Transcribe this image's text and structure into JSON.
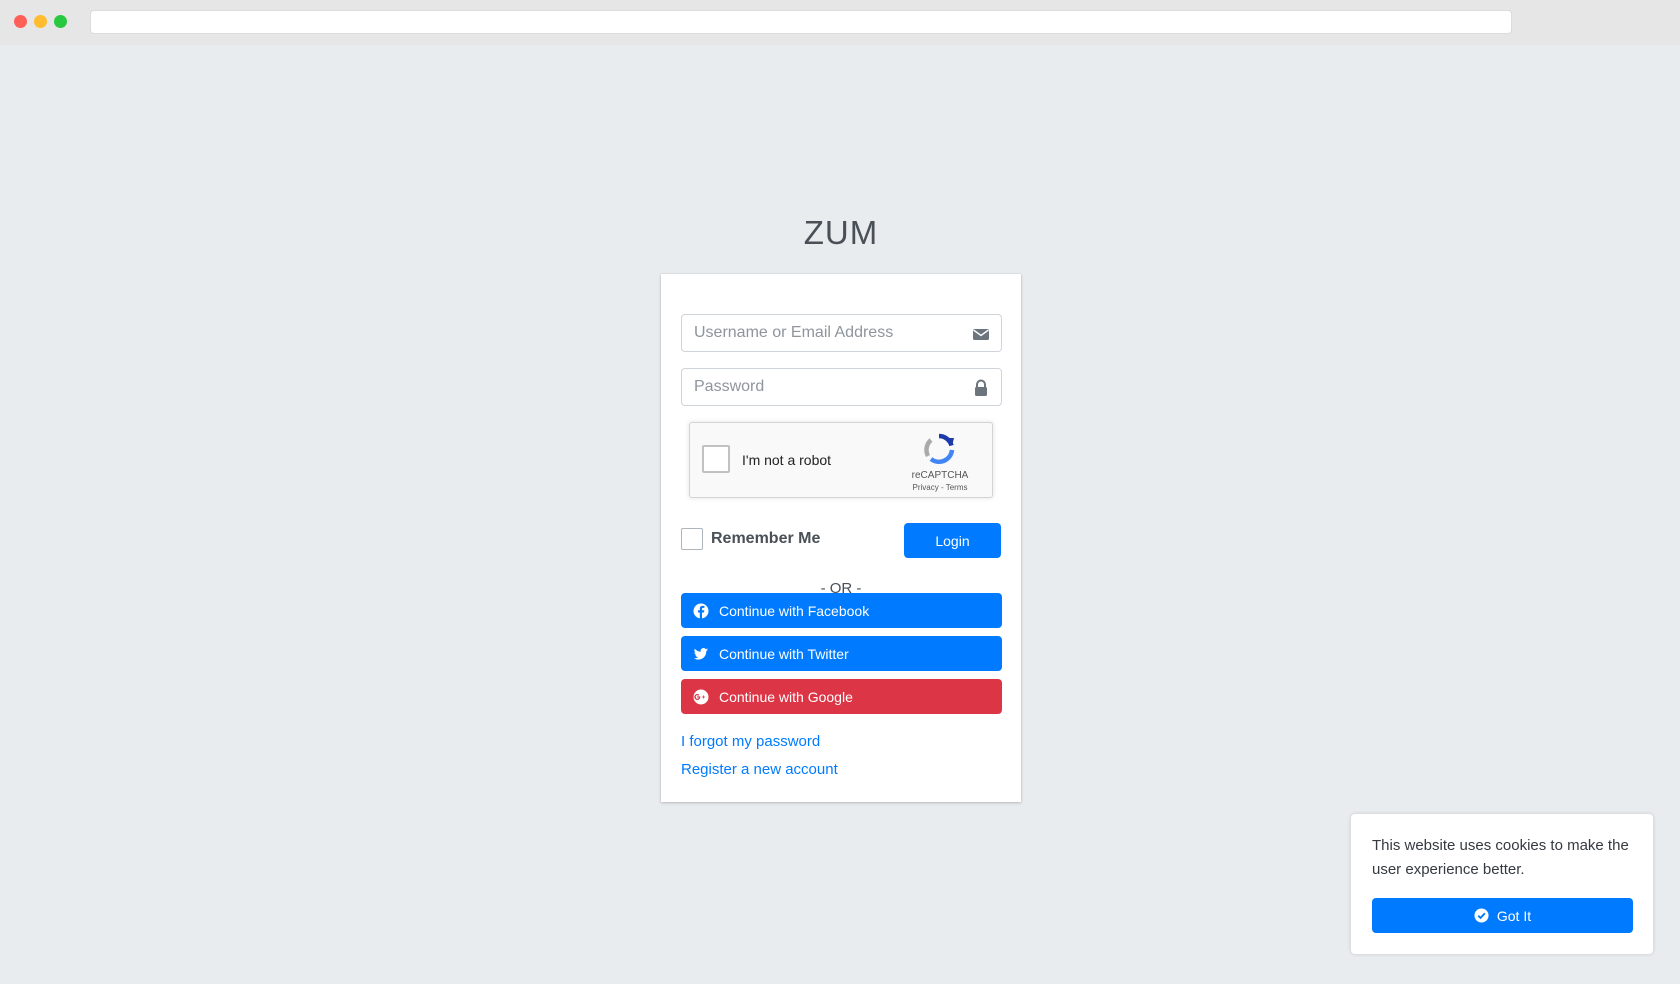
{
  "app": {
    "logo_text": "ZUM"
  },
  "login": {
    "username_placeholder": "Username or Email Address",
    "password_placeholder": "Password",
    "remember_label": "Remember Me",
    "login_label": "Login",
    "or_text": "- OR -",
    "forgot_link": "I forgot my password",
    "register_link": "Register a new account"
  },
  "captcha": {
    "label": "I'm not a robot",
    "brand": "reCAPTCHA",
    "privacy": "Privacy",
    "separator": " - ",
    "terms": "Terms"
  },
  "social": {
    "facebook_label": "Continue with Facebook",
    "twitter_label": "Continue with Twitter",
    "google_label": "Continue with Google"
  },
  "cookie": {
    "message": "This website uses cookies to make the user experience better.",
    "button_label": "Got It"
  },
  "colors": {
    "primary": "#007bff",
    "danger": "#dc3545",
    "background": "#e9ecef"
  }
}
